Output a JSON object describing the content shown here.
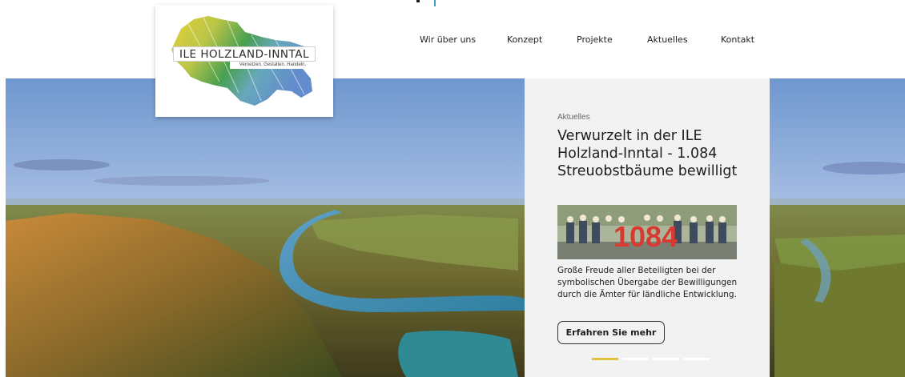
{
  "brand": {
    "name": "ILE HOLZLAND-INNTAL",
    "tagline": "Vernetzen. Gestalten. Handeln.",
    "colors": {
      "yellow": "#d9c63b",
      "green": "#3f9a47",
      "blue": "#5a86c8",
      "accent": "#3aa0c8"
    }
  },
  "nav": {
    "items": [
      {
        "label": "Wir über uns"
      },
      {
        "label": "Konzept"
      },
      {
        "label": "Projekte"
      },
      {
        "label": "Aktuelles"
      },
      {
        "label": "Kontakt"
      }
    ]
  },
  "hero": {
    "image": "aerial-river-landscape-image"
  },
  "news": {
    "category": "Aktuelles",
    "title": "Verwurzelt in der ILE Holzland-Inntal - 1.084 Streuobstbäume bewilligt",
    "image_text": "1084",
    "text": "Große Freude aller Beteiligten bei der symbolischen Übergabe der Bewilligungen durch die Ämter für ländliche Entwicklung.",
    "button": "Erfahren Sie mehr",
    "slides": {
      "count": 4,
      "active": 1,
      "active_color": "#e1c23c"
    }
  }
}
